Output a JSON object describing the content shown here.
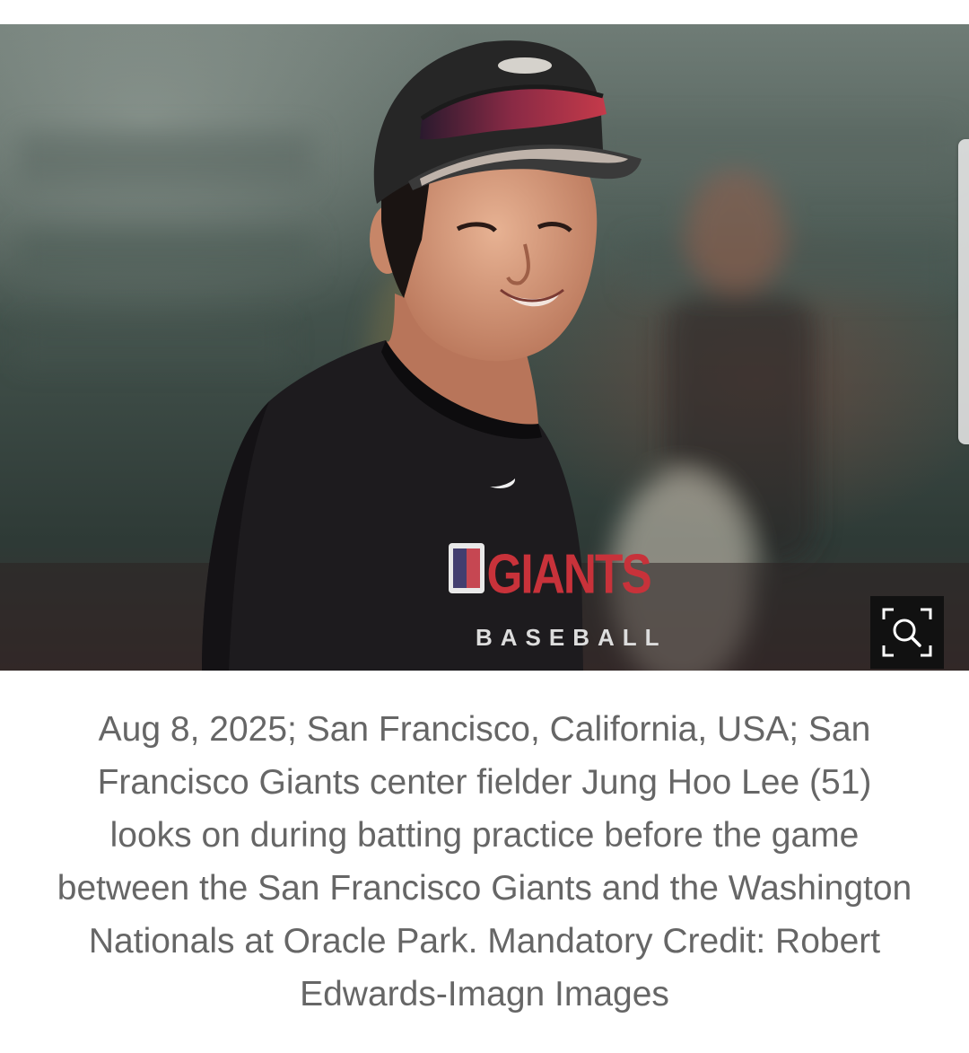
{
  "photo": {
    "alt": "",
    "shirt_text_top": "GIANTS",
    "shirt_text_bottom": "BASEBALL",
    "colors": {
      "background": "#3b4a45",
      "shirt": "#1d1b1e",
      "giants_red": "#c8323a",
      "cap": "#262626",
      "skin": "#d99e7b"
    }
  },
  "zoom_button": {
    "icon": "zoom-in-magnifier-icon"
  },
  "caption": {
    "text": "Aug 8, 2025; San Francisco, California, USA; San Francisco Giants center fielder Jung Hoo Lee (51) looks on during batting practice before the game between the San Francisco Giants and the Washington Nationals at Oracle Park. Mandatory Credit: Robert Edwards-Imagn Images"
  }
}
